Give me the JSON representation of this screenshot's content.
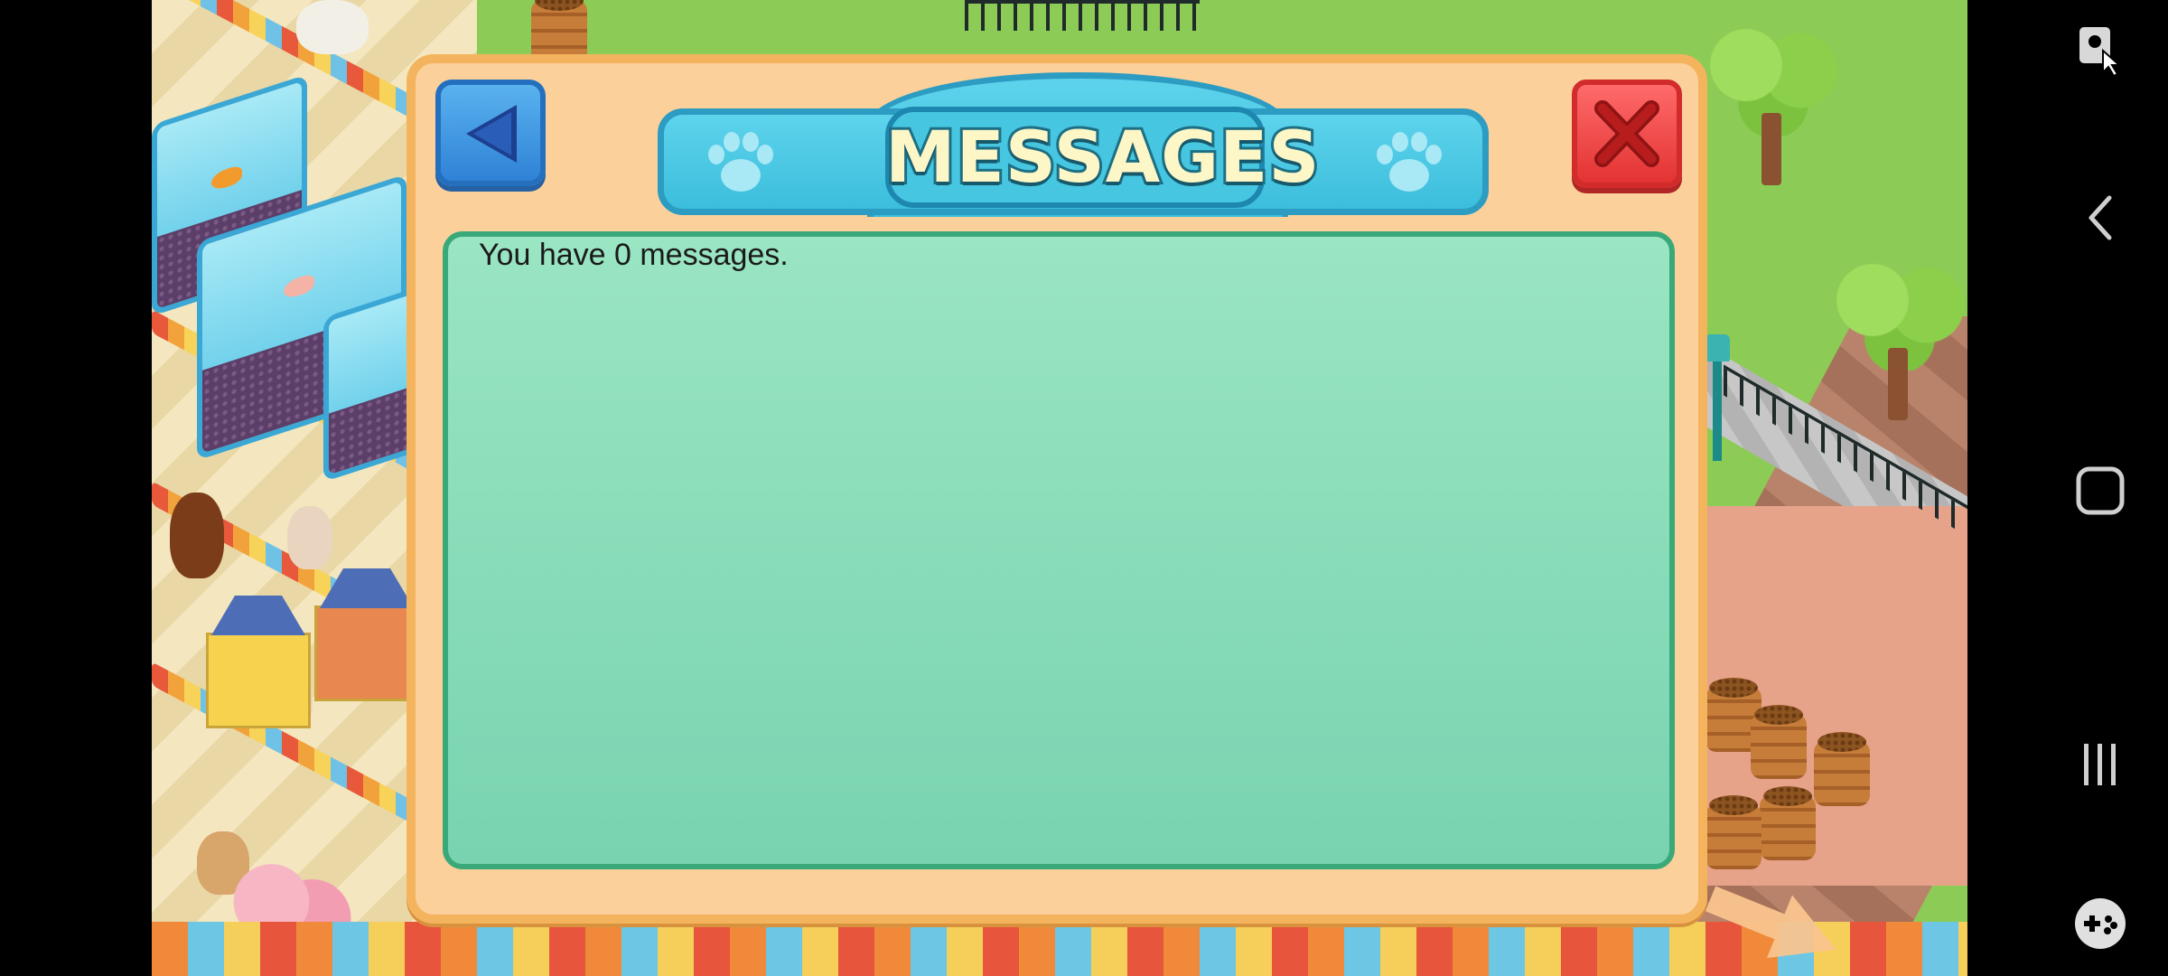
{
  "dialog": {
    "title": "MESSAGES",
    "message_count_text": "You have 0 messages."
  },
  "colors": {
    "dialog_bg": "#fbd09b",
    "dialog_border": "#f4b45e",
    "panel_bg": "#8edbbb",
    "banner": "#46c6e0",
    "title_text": "#fdf6c6",
    "back_button": "#3a93e0",
    "close_button": "#f04545"
  },
  "icons": {
    "back": "triangle-left-icon",
    "close": "x-icon",
    "banner_decor": "paw-print-icon",
    "nav_assist": "touch-assist-icon",
    "nav_back": "chevron-left-icon",
    "nav_home": "square-icon",
    "nav_recents": "three-bars-icon",
    "nav_game": "gamepad-icon"
  }
}
